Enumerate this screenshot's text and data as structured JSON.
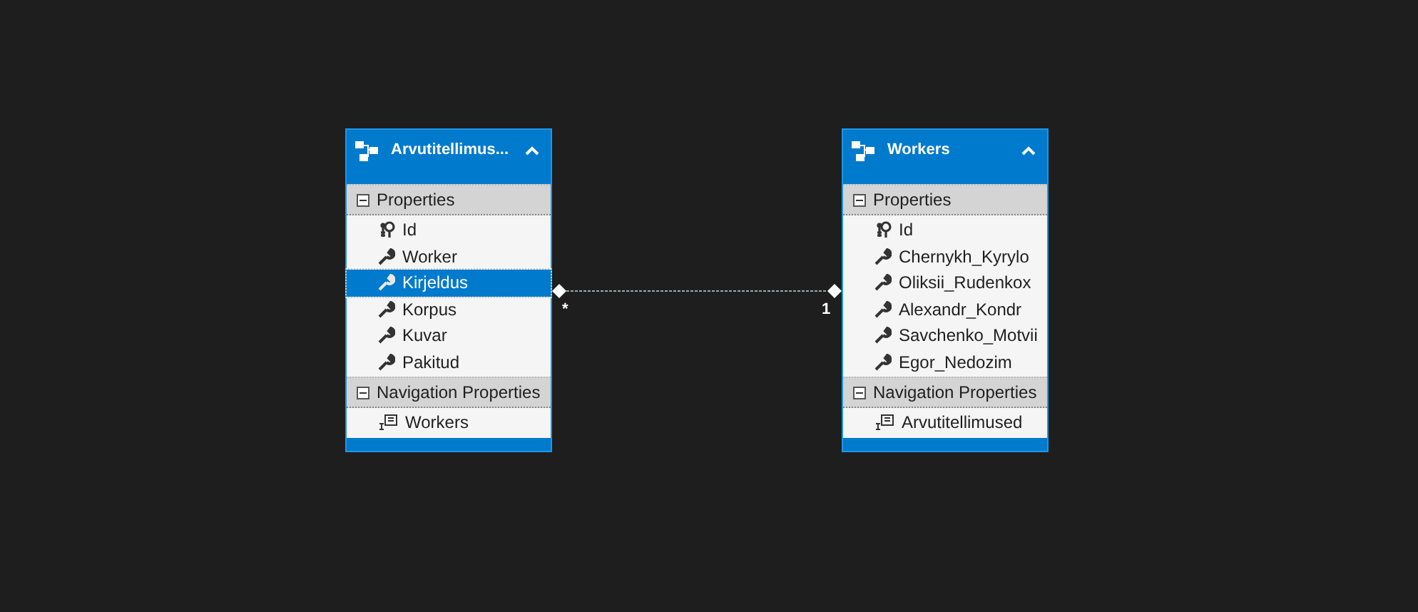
{
  "entities": [
    {
      "title": "Arvutitellimus...",
      "sections": [
        {
          "title": "Properties",
          "expanded": true,
          "items": [
            {
              "label": "Id",
              "kind": "key",
              "selected": false
            },
            {
              "label": "Worker",
              "kind": "property",
              "selected": false
            },
            {
              "label": "Kirjeldus",
              "kind": "property",
              "selected": true
            },
            {
              "label": "Korpus",
              "kind": "property",
              "selected": false
            },
            {
              "label": "Kuvar",
              "kind": "property",
              "selected": false
            },
            {
              "label": "Pakitud",
              "kind": "property",
              "selected": false
            }
          ]
        },
        {
          "title": "Navigation Properties",
          "expanded": true,
          "items": [
            {
              "label": "Workers",
              "kind": "navigation",
              "selected": false
            }
          ]
        }
      ]
    },
    {
      "title": "Workers",
      "sections": [
        {
          "title": "Properties",
          "expanded": true,
          "items": [
            {
              "label": "Id",
              "kind": "key",
              "selected": false
            },
            {
              "label": "Chernykh_Kyrylo",
              "kind": "property",
              "selected": false
            },
            {
              "label": "Oliksii_Rudenkox",
              "kind": "property",
              "selected": false
            },
            {
              "label": "Alexandr_Kondr",
              "kind": "property",
              "selected": false
            },
            {
              "label": "Savchenko_Motvii",
              "kind": "property",
              "selected": false
            },
            {
              "label": "Egor_Nedozim",
              "kind": "property",
              "selected": false
            }
          ]
        },
        {
          "title": "Navigation Properties",
          "expanded": true,
          "items": [
            {
              "label": "Arvutitellimused",
              "kind": "navigation",
              "selected": false
            }
          ]
        }
      ]
    }
  ],
  "association": {
    "left_multiplicity": "*",
    "right_multiplicity": "1"
  }
}
